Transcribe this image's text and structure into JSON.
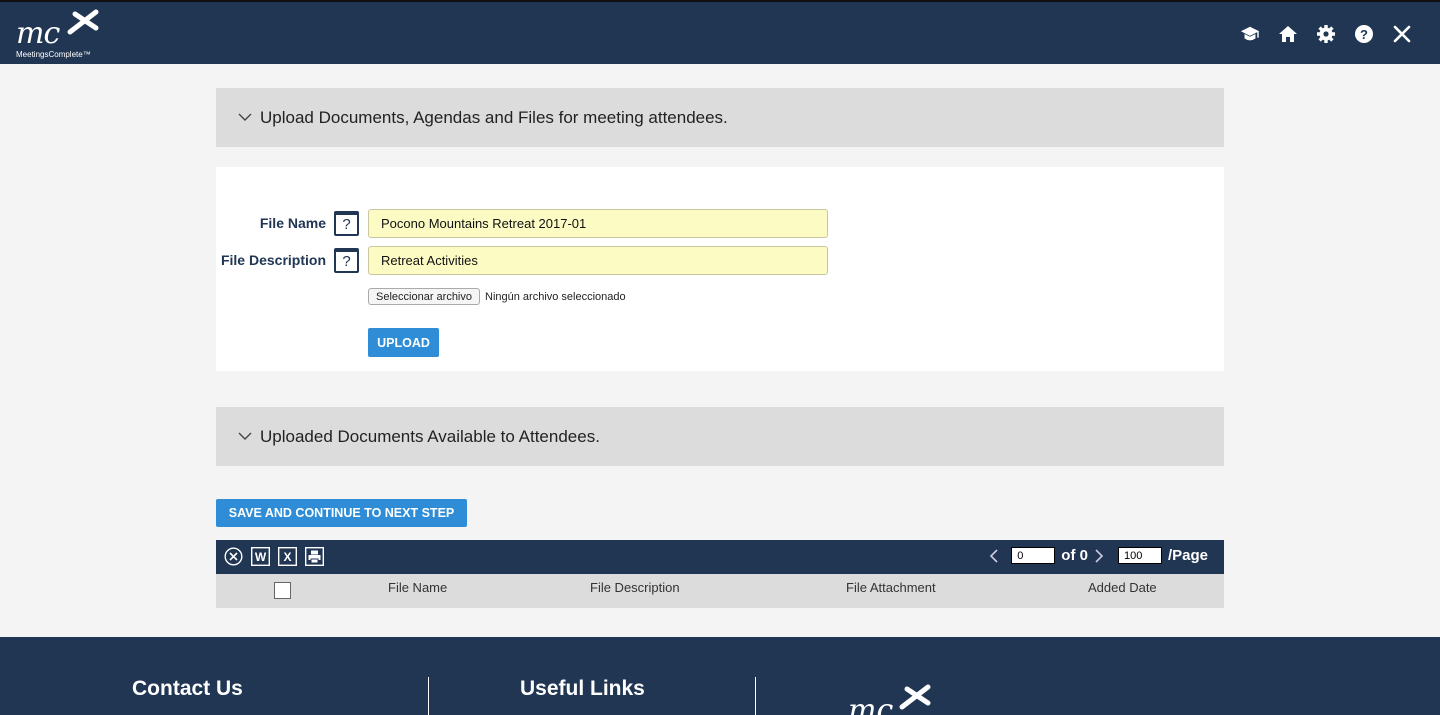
{
  "header": {
    "logo_text": "mc",
    "brand": "MeetingsComplete™",
    "icons": [
      "graduation-cap-icon",
      "home-icon",
      "gear-icon",
      "help-icon",
      "close-icon"
    ]
  },
  "upload_panel": {
    "title": "Upload Documents, Agendas and Files for meeting attendees.",
    "file_name_label": "File Name",
    "file_name_value": "Pocono Mountains Retreat 2017-01",
    "file_description_label": "File Description",
    "file_description_value": "Retreat Activities",
    "help_glyph": "?",
    "choose_file_label": "Seleccionar archivo",
    "no_file_text": "Ningún archivo seleccionado",
    "upload_label": "UPLOAD"
  },
  "uploaded_panel": {
    "title": "Uploaded Documents Available to Attendees."
  },
  "save_button_label": "SAVE AND CONTINUE TO NEXT STEP",
  "grid": {
    "page_value": "0",
    "of_text": "of 0",
    "page_size": "100",
    "per_page_text": "/Page",
    "columns": [
      "File Name",
      "File Description",
      "File Attachment",
      "Added Date"
    ]
  },
  "footer": {
    "contact_title": "Contact Us",
    "links_title": "Useful Links",
    "logo_text": "mc"
  },
  "colors": {
    "navy": "#213653",
    "accent_blue": "#2e8dd6",
    "input_yellow": "#fdfbc4",
    "panel_gray": "#dcdcdc"
  }
}
